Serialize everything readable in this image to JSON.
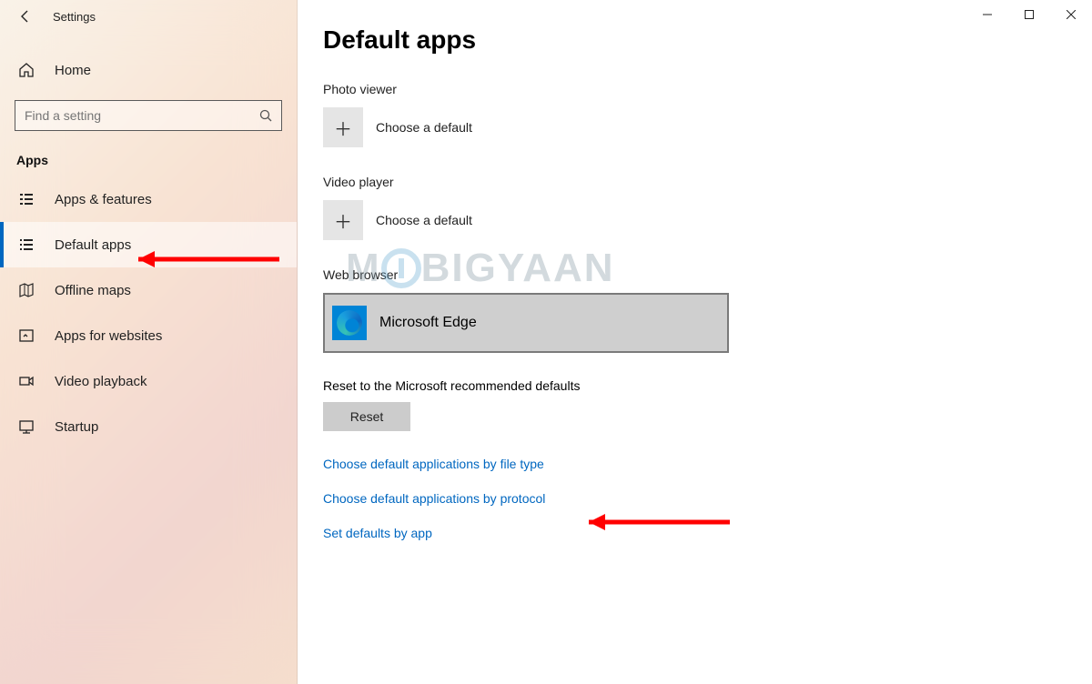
{
  "window": {
    "title": "Settings"
  },
  "sidebar": {
    "home_label": "Home",
    "search_placeholder": "Find a setting",
    "section_title": "Apps",
    "items": [
      {
        "label": "Apps & features"
      },
      {
        "label": "Default apps"
      },
      {
        "label": "Offline maps"
      },
      {
        "label": "Apps for websites"
      },
      {
        "label": "Video playback"
      },
      {
        "label": "Startup"
      }
    ]
  },
  "main": {
    "heading": "Default apps",
    "categories": {
      "photo_viewer": {
        "title": "Photo viewer",
        "choice": "Choose a default"
      },
      "video_player": {
        "title": "Video player",
        "choice": "Choose a default"
      },
      "web_browser": {
        "title": "Web browser",
        "choice": "Microsoft Edge"
      }
    },
    "reset_text": "Reset to the Microsoft recommended defaults",
    "reset_button": "Reset",
    "links": [
      "Choose default applications by file type",
      "Choose default applications by protocol",
      "Set defaults by app"
    ]
  },
  "watermark": {
    "prefix": "M",
    "suffix": "BIGYAAN"
  }
}
